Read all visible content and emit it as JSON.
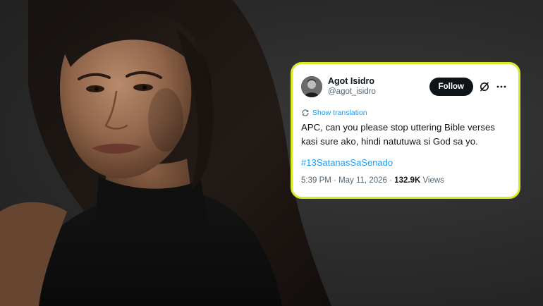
{
  "background": {
    "color": "#2e2e2e",
    "photo": "portrait of a woman with long dark hair in a black turtleneck"
  },
  "card": {
    "border_color": "#d8ea24"
  },
  "tweet": {
    "author": {
      "display_name": "Agot Isidro",
      "handle": "@agot_isidro"
    },
    "follow_label": "Follow",
    "grok_icon": "slash-circle-icon",
    "more_icon": "more-dots-icon",
    "translate_icon": "translate-icon",
    "translate_label": "Show translation",
    "text_line1": "APC, can you please stop uttering Bible verses",
    "text_line2": "kasi sure ako, hindi natutuwa si God sa yo.",
    "hashtag": "#13SatanasSaSenado",
    "time": "5:39 PM",
    "separator": "·",
    "date": "May 11, 2026",
    "views_count": "132.9K",
    "views_label": "Views",
    "colors": {
      "link": "#1d9bf0",
      "text": "#0f1419",
      "muted": "#536471"
    }
  }
}
